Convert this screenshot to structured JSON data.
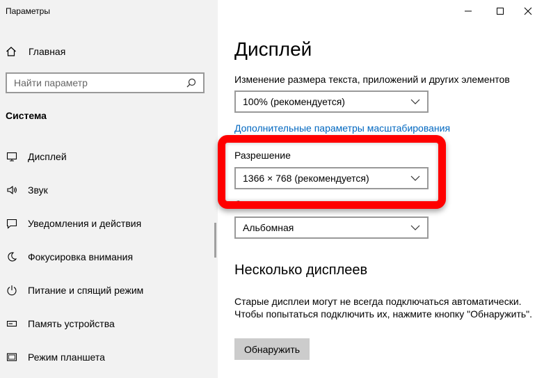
{
  "window": {
    "title": "Параметры",
    "accent": "#0067c0",
    "highlight_color": "#ff0000"
  },
  "sidebar": {
    "home_label": "Главная",
    "search_placeholder": "Найти параметр",
    "section_title": "Система",
    "items": [
      {
        "label": "Дисплей",
        "icon": "monitor-icon"
      },
      {
        "label": "Звук",
        "icon": "speaker-icon"
      },
      {
        "label": "Уведомления и действия",
        "icon": "notification-icon"
      },
      {
        "label": "Фокусировка внимания",
        "icon": "moon-icon"
      },
      {
        "label": "Питание и спящий режим",
        "icon": "power-icon"
      },
      {
        "label": "Память устройства",
        "icon": "storage-icon"
      },
      {
        "label": "Режим планшета",
        "icon": "tablet-icon"
      }
    ]
  },
  "main": {
    "title": "Дисплей",
    "scale_label": "Изменение размера текста, приложений и других элементов",
    "scale_value": "100% (рекомендуется)",
    "advanced_link": "Дополнительные параметры масштабирования",
    "resolution_label": "Разрешение",
    "resolution_value": "1366 × 768 (рекомендуется)",
    "orientation_label": "Ориентация",
    "orientation_value": "Альбомная",
    "multi_title": "Несколько дисплеев",
    "multi_desc": "Старые дисплеи могут не всегда подключаться автоматически. Чтобы попытаться подключить их, нажмите кнопку \"Обнаружить\".",
    "detect_button": "Обнаружить"
  }
}
